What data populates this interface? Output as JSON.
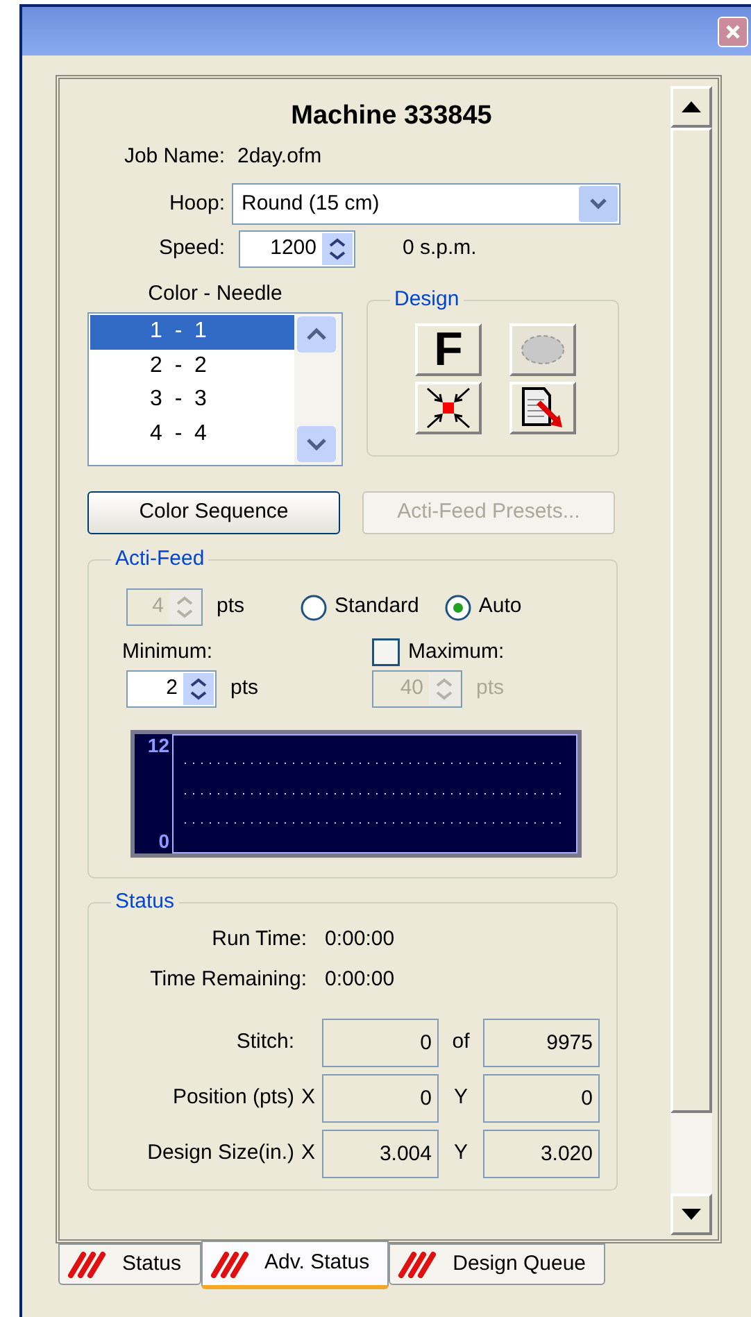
{
  "title": "Machine 333845",
  "job": {
    "label": "Job Name:",
    "value": "2day.ofm"
  },
  "hoop": {
    "label": "Hoop:",
    "value": "Round (15 cm)"
  },
  "speed": {
    "label": "Speed:",
    "value": "1200",
    "reading": "0 s.p.m."
  },
  "color_needle": {
    "label": "Color - Needle",
    "items": [
      {
        "text": "1  -  1",
        "selected": true
      },
      {
        "text": "2  -  2",
        "selected": false
      },
      {
        "text": "3  -  3",
        "selected": false
      },
      {
        "text": "4  -  4",
        "selected": false
      }
    ]
  },
  "design": {
    "title": "Design",
    "buttons": [
      {
        "kind": "letter",
        "text": "F",
        "disabled": false
      },
      {
        "kind": "outline",
        "disabled": true
      },
      {
        "kind": "center",
        "disabled": false
      },
      {
        "kind": "page-arrow",
        "disabled": false
      }
    ]
  },
  "buttons": [
    {
      "label": "Color Sequence",
      "disabled": false
    },
    {
      "label": "Acti-Feed Presets...",
      "disabled": true
    }
  ],
  "acti_feed": {
    "title": "Acti-Feed",
    "value": "4",
    "unit": "pts",
    "disabled": true,
    "modes": [
      {
        "label": "Standard",
        "selected": false
      },
      {
        "label": "Auto",
        "selected": true
      }
    ],
    "minimum": {
      "label": "Minimum:",
      "value": "2",
      "unit": "pts",
      "disabled": false
    },
    "maximum": {
      "label": "Maximum:",
      "checked": false,
      "value": "40",
      "unit": "pts",
      "disabled": true
    },
    "graph": {
      "top_label": "12",
      "bottom_label": "0"
    }
  },
  "status": {
    "title": "Status",
    "times": [
      {
        "label": "Run Time:",
        "value": "0:00:00"
      },
      {
        "label": "Time Remaining:",
        "value": "0:00:00"
      }
    ],
    "rows": [
      {
        "label": "Stitch:",
        "value_1": "0",
        "separator": "of",
        "value_2": "9975"
      },
      {
        "label": "Position (pts)",
        "axis": "X",
        "value_1": "0",
        "separator": "Y",
        "value_2": "0"
      },
      {
        "label": "Design Size(in.)",
        "axis": "X",
        "value_1": "3.004",
        "separator": "Y",
        "value_2": "3.020"
      }
    ]
  },
  "tabs": [
    {
      "label": "Status",
      "selected": false
    },
    {
      "label": "Adv. Status",
      "selected": true
    },
    {
      "label": "Design Queue",
      "selected": false
    }
  ]
}
